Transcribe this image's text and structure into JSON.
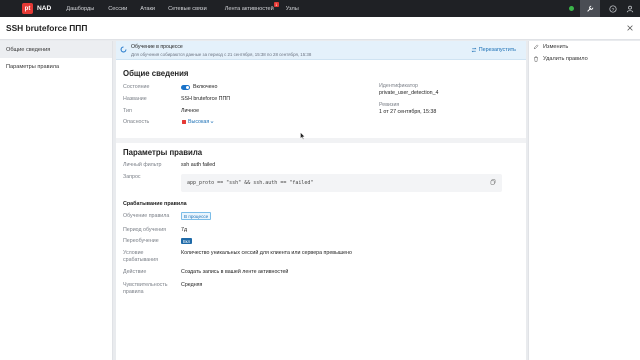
{
  "app": {
    "logo_mark": "pt",
    "logo_text": "NAD",
    "nav": [
      {
        "label": "Дашборды"
      },
      {
        "label": "Сессии"
      },
      {
        "label": "Атаки"
      },
      {
        "label": "Сетевые связи"
      },
      {
        "label": "Лента активностей",
        "badge": "1"
      },
      {
        "label": "Узлы"
      }
    ],
    "status_color": "#3bb54a"
  },
  "page": {
    "title": "SSH bruteforce ППП"
  },
  "sidebar": {
    "items": [
      {
        "label": "Общие сведения",
        "active": true
      },
      {
        "label": "Параметры правила",
        "active": false
      }
    ]
  },
  "banner": {
    "title": "Обучение в процессе",
    "subtitle": "Для обучения собираются данные за период с 21 сентября, 15:38 по 28 сентября, 15:38",
    "action": "Перезапустить"
  },
  "general": {
    "title": "Общие сведения",
    "state_label": "Состояние",
    "state_value": "Включено",
    "name_label": "Название",
    "name_value": "SSH bruteforce ППП",
    "type_label": "Тип",
    "type_value": "Личное",
    "severity_label": "Опасность",
    "severity_value": "Высокая",
    "id_label": "Идентификатор",
    "id_value": "private_user_detection_4",
    "revision_label": "Ревизия",
    "revision_value": "1 от 27 сентября, 15:38"
  },
  "params": {
    "title": "Параметры правила",
    "filter_label": "Личный фильтр",
    "filter_value": "ssh auth failed",
    "query_label": "Запрос",
    "query_value": "app_proto == \"ssh\" && ssh.auth == \"failed\"",
    "triggers_title": "Срабатывание правила",
    "training_label": "Обучение правила",
    "training_value": "В процессе",
    "period_label": "Период обучения",
    "period_value": "7д",
    "retrain_label": "Переобучение",
    "retrain_value": "Вкл",
    "condition_label_1": "Условие",
    "condition_label_2": "срабатывания",
    "condition_value": "Количество уникальных сессий для клиента или сервера превышено",
    "action_label": "Действие",
    "action_value": "Создать запись в вашей ленте активностей",
    "sensitivity_label_1": "Чувствительность",
    "sensitivity_label_2": "правила",
    "sensitivity_value": "Средняя"
  },
  "actions": {
    "edit": "Изменить",
    "delete": "Удалить правило"
  },
  "colors": {
    "accent": "#1a73c9",
    "danger": "#e53935",
    "topbar": "#1f2125"
  }
}
